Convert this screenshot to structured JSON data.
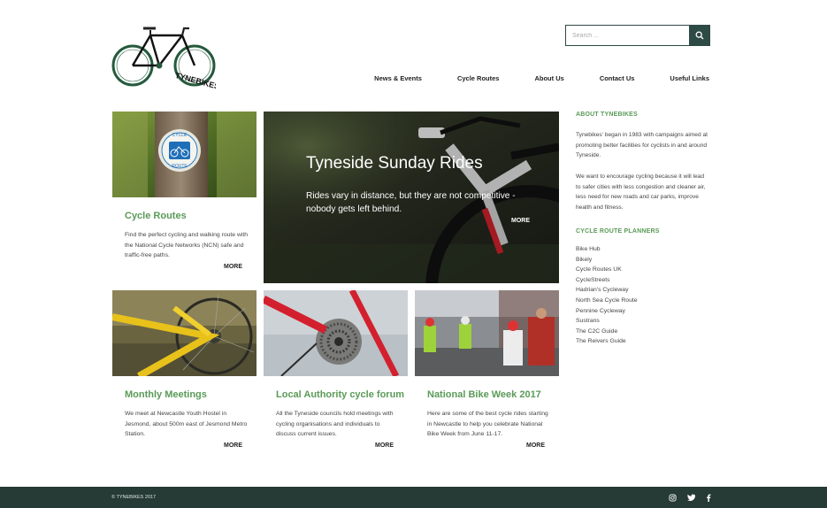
{
  "brand": {
    "logo_text": "TYNEBIKES"
  },
  "search": {
    "placeholder": "Search ..."
  },
  "nav": [
    "News & Events",
    "Cycle Routes",
    "About Us",
    "Contact Us",
    "Useful Links"
  ],
  "hero": {
    "title": "Tyneside Sunday Rides",
    "subtitle": "Rides vary in distance, but they are not competitive - nobody gets left behind.",
    "more": "MORE"
  },
  "cards": [
    {
      "title": "Cycle Routes",
      "text": "Find the perfect cycling and walking route with the National Cycle Networks (NCN) safe and traffic-free paths.",
      "more": "MORE",
      "sign_top": "CYCLE",
      "sign_bottom": "ROUTE"
    },
    {
      "title": "Monthly Meetings",
      "text": "We meet at Newcastle Youth Hostel in Jesmond, about 500m east of Jesmond Metro Station.",
      "more": "MORE"
    },
    {
      "title": "Local Authority cycle forum",
      "text": "All the Tyneside councils hold meetings with cycling organisations and individuals to discuss current issues.",
      "more": "MORE"
    },
    {
      "title": "National Bike Week 2017",
      "text": "Here are some of the best cycle rides starting in Newcastle to help you celebrate National Bike Week from June 11-17.",
      "more": "MORE"
    }
  ],
  "sidebar": {
    "about_heading": "ABOUT TYNEBIKES",
    "about_p1": "Tynebikes' began in 1983 with campaigns aimed at promoting better facilities for cyclists in and around Tyneside.",
    "about_p2": "We want to encourage cycling because it will lead to safer cities with less congestion and cleaner air, less need for new roads and car parks, improve health and fitness.",
    "planners_heading": "CYCLE ROUTE PLANNERS",
    "planners": [
      "Bike Hub",
      "Bikely",
      "Cycle Routes UK",
      "CycleStreets",
      "Hadrian's Cycleway",
      "North Sea Cycle Route",
      "Pennine Cycleway",
      "Sustrans",
      "The C2C Guide",
      "The Reivers Guide"
    ]
  },
  "footer": {
    "copyright": "© TYNEBIKES 2017",
    "social": [
      "instagram-icon",
      "twitter-icon",
      "facebook-icon"
    ]
  },
  "colors": {
    "accent": "#5a9a57",
    "dark": "#263a36",
    "search_button": "#2e4a45"
  }
}
